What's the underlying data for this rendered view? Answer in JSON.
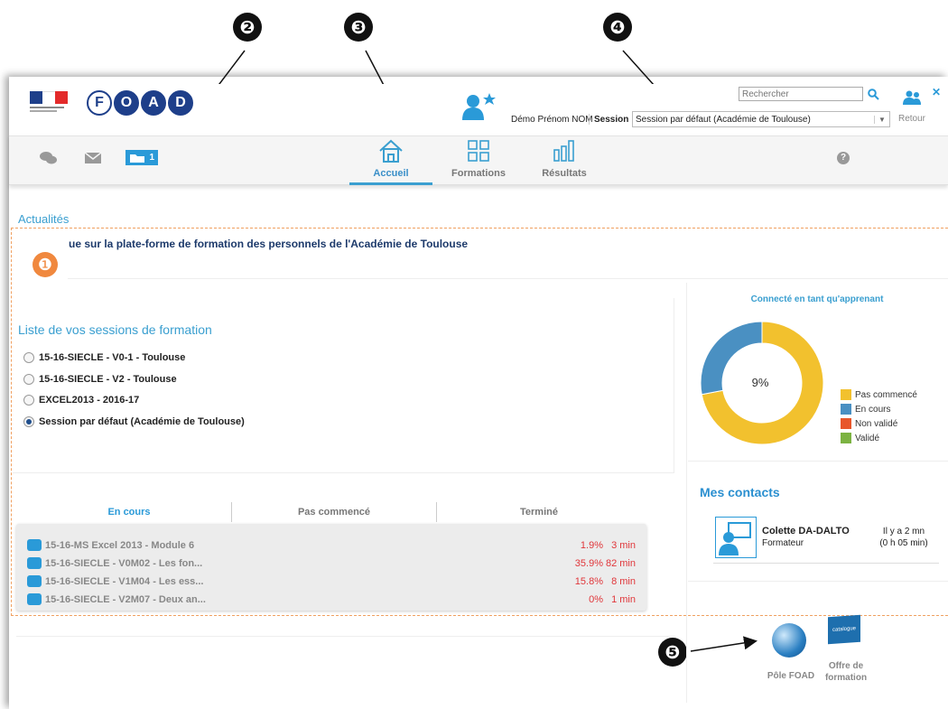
{
  "markers": [
    "❶",
    "❷",
    "❸",
    "❹",
    "❺"
  ],
  "header": {
    "foad_letters": [
      "F",
      "O",
      "A",
      "D"
    ],
    "user_name": "Démo Prénom NOM",
    "session_label": "Session :",
    "session_value": "Session par défaut (Académie de Toulouse)",
    "search_placeholder": "Rechercher",
    "back_label": "Retour"
  },
  "toolbar": {
    "folder_badge": "1"
  },
  "nav": {
    "home": "Accueil",
    "trainings": "Formations",
    "results": "Résultats"
  },
  "news": {
    "title": "Actualités",
    "text": "ue sur la plate-forme de formation des personnels de l'Académie de Toulouse"
  },
  "sessions": {
    "title": "Liste de vos sessions de formation",
    "items": [
      {
        "label": "15-16-SIECLE - V0-1 - Toulouse",
        "selected": false
      },
      {
        "label": "15-16-SIECLE - V2 - Toulouse",
        "selected": false
      },
      {
        "label": "EXCEL2013 - 2016-17",
        "selected": false
      },
      {
        "label": "Session par défaut (Académie de Toulouse)",
        "selected": true
      }
    ]
  },
  "course_tabs": [
    "En cours",
    "Pas commencé",
    "Terminé"
  ],
  "courses": [
    {
      "name": "15-16-MS Excel 2013 - Module 6",
      "pct": "1.9%",
      "time": "3 min"
    },
    {
      "name": "15-16-SIECLE - V0M02 - Les fon...",
      "pct": "35.9%",
      "time": "82 min"
    },
    {
      "name": "15-16-SIECLE - V1M04 - Les ess...",
      "pct": "15.8%",
      "time": "8 min"
    },
    {
      "name": "15-16-SIECLE - V2M07 - Deux an...",
      "pct": "0%",
      "time": "1 min"
    }
  ],
  "progress": {
    "title": "Connecté en tant qu'apprenant",
    "center_label": "9%",
    "slices": [
      {
        "name": "Pas commencé",
        "value": 72,
        "color": "#f2c12e"
      },
      {
        "name": "En cours",
        "value": 28,
        "color": "#4a90c2"
      },
      {
        "name": "Non validé",
        "value": 0,
        "color": "#e8562a"
      },
      {
        "name": "Validé",
        "value": 0,
        "color": "#7cb342"
      }
    ]
  },
  "contacts": {
    "title": "Mes contacts",
    "name": "Colette DA-DALTO",
    "role": "Formateur",
    "ago": "Il y a 2 mn",
    "duration": "(0 h 05 min)"
  },
  "links": {
    "pole": "Pôle FOAD",
    "offre_line1": "Offre de",
    "offre_line2": "formation",
    "catalogue": "catalogue"
  },
  "colors": {
    "accent": "#3a9fd0",
    "dash": "#f0a060"
  }
}
